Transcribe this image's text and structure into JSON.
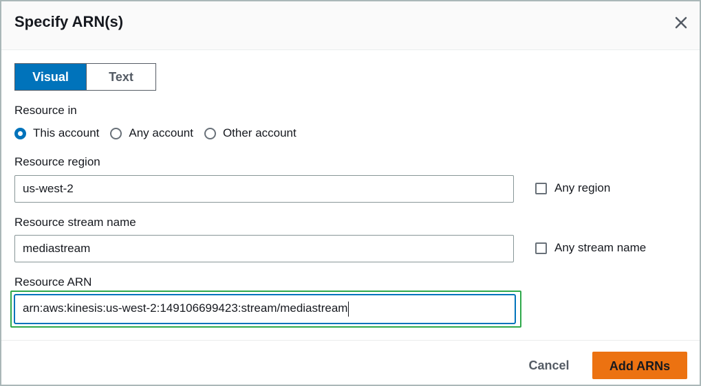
{
  "dialog": {
    "title": "Specify ARN(s)"
  },
  "mode_tabs": [
    {
      "label": "Visual",
      "active": true
    },
    {
      "label": "Text",
      "active": false
    }
  ],
  "resource_in": {
    "label": "Resource in",
    "options": [
      {
        "label": "This account",
        "checked": true
      },
      {
        "label": "Any account",
        "checked": false
      },
      {
        "label": "Other account",
        "checked": false
      }
    ]
  },
  "region": {
    "label": "Resource region",
    "value": "us-west-2",
    "any_label": "Any region",
    "any_checked": false
  },
  "stream": {
    "label": "Resource stream name",
    "value": "mediastream",
    "any_label": "Any stream name",
    "any_checked": false
  },
  "arn": {
    "label": "Resource ARN",
    "value": "arn:aws:kinesis:us-west-2:149106699423:stream/mediastream"
  },
  "footer": {
    "cancel_label": "Cancel",
    "add_label": "Add ARNs"
  },
  "colors": {
    "accent": "#0073bb",
    "primary_button": "#ec7211",
    "highlight": "#2ea84a"
  }
}
